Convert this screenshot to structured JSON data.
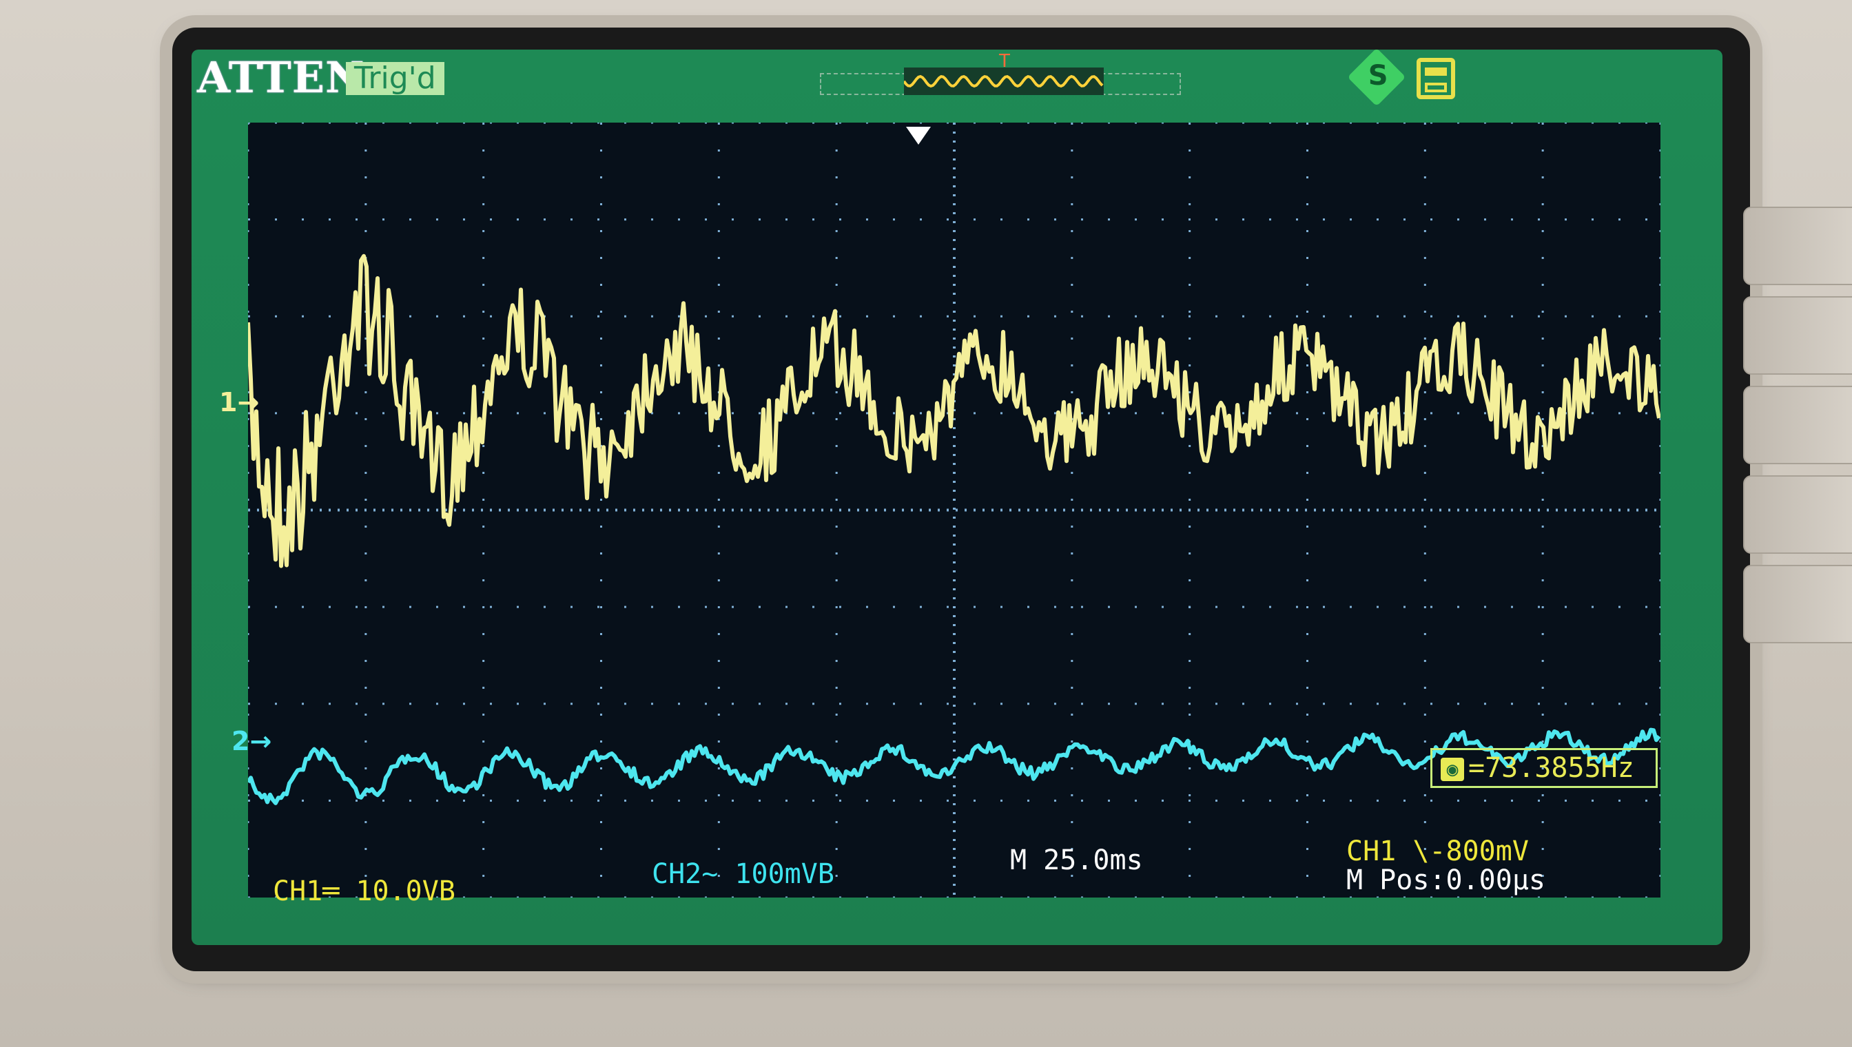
{
  "header": {
    "brand": "ATTEN",
    "trigger_status": "Trig'd",
    "trigger_marker_label": "T",
    "icons": [
      "usb-storage-icon",
      "printer-icon"
    ]
  },
  "channels": {
    "ch1_marker": "1",
    "ch2_marker": "2",
    "ch1_color": "#f4ef9a",
    "ch2_color": "#4ee6ef"
  },
  "measurement": {
    "frequency": "=73.3855Hz"
  },
  "status_bar": {
    "ch1_scale": "CH1═ 10.0VB",
    "ch2_scale": "CH2~ 100mVB",
    "timebase": "M 25.0ms",
    "trigger": "CH1 \\-800mV",
    "m_pos": "M Pos:0.00µs"
  },
  "colors": {
    "screen_bg": "#1e8a55",
    "grid_bg": "#07101a",
    "grid_dot": "#7fb0d6"
  }
}
